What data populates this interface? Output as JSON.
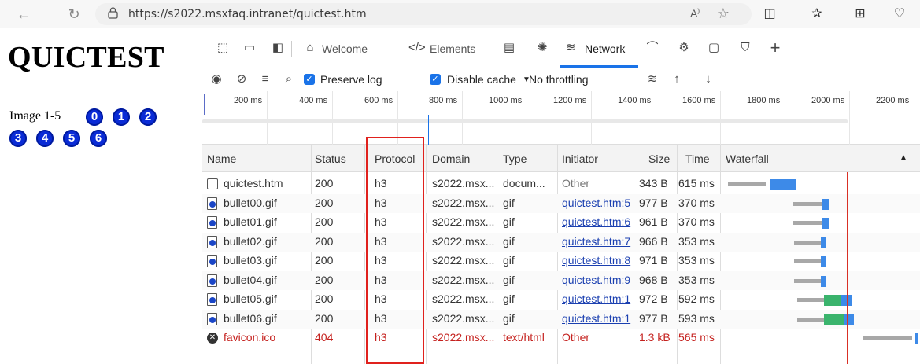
{
  "browser": {
    "url": "https://s2022.msxfaq.intranet/quictest.htm",
    "icons": [
      "back-icon",
      "refresh-icon",
      "lock-icon",
      "read-aloud-icon",
      "favorite-star-icon",
      "split-screen-icon",
      "favorites-icon",
      "collections-icon",
      "heart-icon"
    ]
  },
  "page": {
    "title": "QUICTEST",
    "image_label": "Image 1-5",
    "bullets": [
      "0",
      "1",
      "2",
      "3",
      "4",
      "5",
      "6"
    ]
  },
  "devtools": {
    "tabs": [
      {
        "label": "Welcome",
        "icon": "home-icon"
      },
      {
        "label": "Elements",
        "icon": "code-icon"
      },
      {
        "label": "Network",
        "icon": "wifi-icon",
        "active": true
      }
    ],
    "toolbar": {
      "preserve_log": "Preserve log",
      "disable_cache": "Disable cache",
      "throttling": "No throttling"
    },
    "overview_ticks": [
      "200 ms",
      "400 ms",
      "600 ms",
      "800 ms",
      "1000 ms",
      "1200 ms",
      "1400 ms",
      "1600 ms",
      "1800 ms",
      "2000 ms",
      "2200 ms"
    ],
    "columns": [
      "Name",
      "Status",
      "Protocol",
      "Domain",
      "Type",
      "Initiator",
      "Size",
      "Time",
      "Waterfall"
    ],
    "rows": [
      {
        "name": "quictest.htm",
        "status": "200",
        "protocol": "h3",
        "domain": "s2022.msx...",
        "type": "docum...",
        "initiator": "Other",
        "size": "343 B",
        "time": "615 ms",
        "kind": "doc"
      },
      {
        "name": "bullet00.gif",
        "status": "200",
        "protocol": "h3",
        "domain": "s2022.msx...",
        "type": "gif",
        "initiator": "quictest.htm:5",
        "size": "977 B",
        "time": "370 ms",
        "kind": "img"
      },
      {
        "name": "bullet01.gif",
        "status": "200",
        "protocol": "h3",
        "domain": "s2022.msx...",
        "type": "gif",
        "initiator": "quictest.htm:6",
        "size": "961 B",
        "time": "370 ms",
        "kind": "img"
      },
      {
        "name": "bullet02.gif",
        "status": "200",
        "protocol": "h3",
        "domain": "s2022.msx...",
        "type": "gif",
        "initiator": "quictest.htm:7",
        "size": "966 B",
        "time": "353 ms",
        "kind": "img"
      },
      {
        "name": "bullet03.gif",
        "status": "200",
        "protocol": "h3",
        "domain": "s2022.msx...",
        "type": "gif",
        "initiator": "quictest.htm:8",
        "size": "971 B",
        "time": "353 ms",
        "kind": "img"
      },
      {
        "name": "bullet04.gif",
        "status": "200",
        "protocol": "h3",
        "domain": "s2022.msx...",
        "type": "gif",
        "initiator": "quictest.htm:9",
        "size": "968 B",
        "time": "353 ms",
        "kind": "img"
      },
      {
        "name": "bullet05.gif",
        "status": "200",
        "protocol": "h3",
        "domain": "s2022.msx...",
        "type": "gif",
        "initiator": "quictest.htm:1",
        "size": "972 B",
        "time": "592 ms",
        "kind": "img"
      },
      {
        "name": "bullet06.gif",
        "status": "200",
        "protocol": "h3",
        "domain": "s2022.msx...",
        "type": "gif",
        "initiator": "quictest.htm:1",
        "size": "977 B",
        "time": "593 ms",
        "kind": "img"
      },
      {
        "name": "favicon.ico",
        "status": "404",
        "protocol": "h3",
        "domain": "s2022.msx...",
        "type": "text/html",
        "initiator": "Other",
        "size": "1.3 kB",
        "time": "565 ms",
        "kind": "err"
      }
    ]
  }
}
